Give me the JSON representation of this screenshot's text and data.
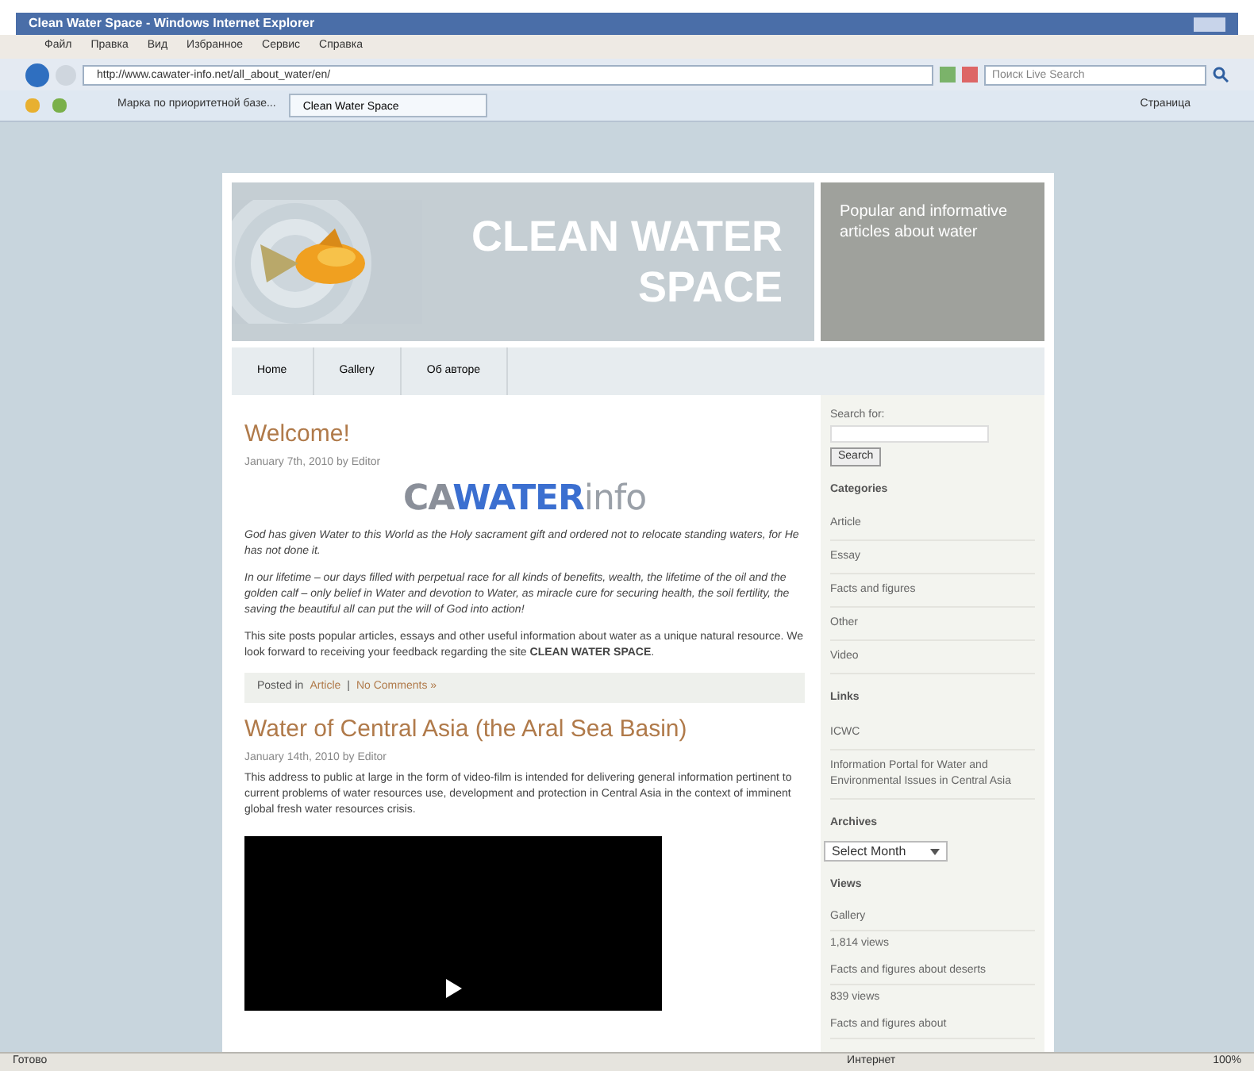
{
  "window": {
    "title": "Clean Water Space - Windows Internet Explorer"
  },
  "menu": [
    "Файл",
    "Правка",
    "Вид",
    "Избранное",
    "Сервис",
    "Справка"
  ],
  "address": {
    "value": "http://www.cawater-info.net/all_about_water/en/"
  },
  "search": {
    "placeholder": "Поиск Live Search"
  },
  "favorites": {
    "link": "Марка по приоритетной базе...",
    "tabs": [
      {
        "label": "Clean Water Space",
        "selected": true
      }
    ],
    "page_menu": "Страница"
  },
  "site": {
    "title_lines": [
      "CLEAN WATER",
      "SPACE"
    ],
    "tagline": "Popular and informative articles about water",
    "nav": [
      {
        "label": "Home",
        "selected": false
      },
      {
        "label": "Gallery",
        "selected": false
      },
      {
        "label": "Об авторе",
        "selected": false
      }
    ]
  },
  "posts": [
    {
      "title": "Welcome!",
      "meta": "January 7th, 2010 by Editor",
      "logo": [
        "CA",
        "WATER",
        "info"
      ],
      "paragraphs": [
        {
          "text": "God has given Water to this World as the Holy sacrament gift and ordered not to relocate standing waters, for He has not done it.",
          "italic": true
        },
        {
          "text": "In our lifetime – our days filled with perpetual race for all kinds of benefits, wealth, the lifetime of the oil and the golden calf – only belief in Water and devotion to Water, as miracle cure for securing health, the soil fertility, the saving the beautiful all can put the will of God into action!",
          "italic": true
        },
        {
          "text": "This site posts popular articles, essays and other useful information about water as a unique natural resource. We look forward to receiving your feedback regarding the site **CLEAN WATER SPACE**.",
          "italic": false
        }
      ],
      "footer": {
        "prefix": "Posted in",
        "category": "Article",
        "separator": "|",
        "comments": "No Comments »"
      }
    },
    {
      "title": "Water of Central Asia (the Aral Sea Basin)",
      "meta": "January 14th, 2010 by Editor",
      "paragraphs": [
        {
          "text": "This address to public at large in the form of video-film is intended for delivering general information pertinent to current problems of water resources use, development and protection in Central Asia in the context of imminent global fresh water resources crisis.",
          "italic": false
        }
      ],
      "video": true
    }
  ],
  "sidebar": {
    "search_label": "Search for:",
    "search_button": "Search",
    "sections": [
      {
        "kind": "list",
        "heading": "Categories",
        "items": [
          "Article",
          "Essay",
          "Facts and figures",
          "Other",
          "Video"
        ]
      },
      {
        "kind": "list",
        "heading": "Links",
        "items": [
          "ICWC",
          "Information Portal for Water and Environmental Issues in Central Asia"
        ]
      },
      {
        "kind": "select",
        "heading": "Archives",
        "value": "Select Month"
      },
      {
        "kind": "views",
        "heading": "Views",
        "items": [
          {
            "title": "Gallery",
            "count": "1,814 views"
          },
          {
            "title": "Facts and figures about deserts",
            "count": "839 views"
          },
          {
            "title": "Facts and figures about"
          }
        ]
      }
    ]
  },
  "status_bar": {
    "text": "Готово",
    "zone": "Интернет",
    "zoom": "100%"
  }
}
